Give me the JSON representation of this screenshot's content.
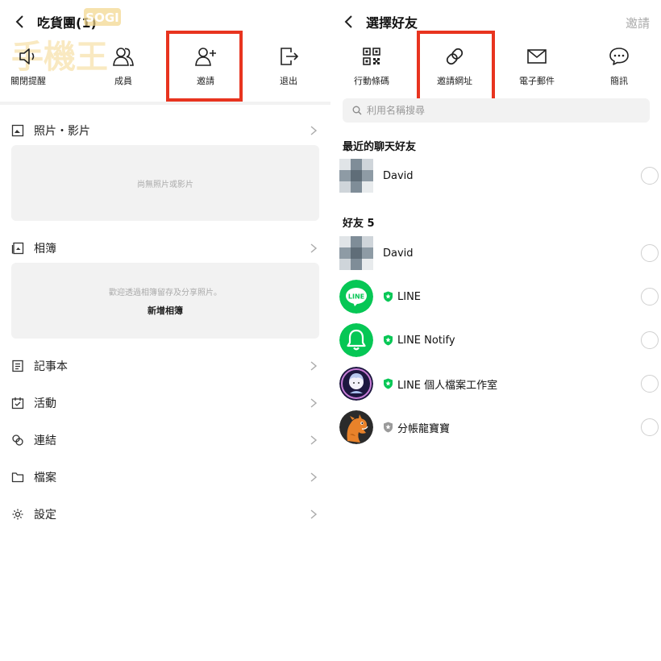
{
  "left": {
    "header": {
      "title": "吃貨團(1)"
    },
    "actions": [
      {
        "label": "關閉提醒",
        "icon": "speaker-icon"
      },
      {
        "label": "成員",
        "icon": "members-icon"
      },
      {
        "label": "邀請",
        "icon": "add-person-icon"
      },
      {
        "label": "退出",
        "icon": "exit-icon"
      }
    ],
    "sections": {
      "photos": {
        "label": "照片・影片",
        "empty_text": "尚無照片或影片"
      },
      "albums": {
        "label": "相簿",
        "empty_text": "歡迎透過相簿留存及分享照片。",
        "create_label": "新增相簿"
      },
      "notes": {
        "label": "記事本"
      },
      "events": {
        "label": "活動"
      },
      "links": {
        "label": "連結"
      },
      "files": {
        "label": "檔案"
      },
      "settings": {
        "label": "設定"
      }
    },
    "watermark": {
      "text": "SOGI"
    }
  },
  "right": {
    "header": {
      "title": "選擇好友",
      "action": "邀請"
    },
    "actions": [
      {
        "label": "行動條碼",
        "icon": "qr-code-icon"
      },
      {
        "label": "邀請網址",
        "icon": "link-icon"
      },
      {
        "label": "電子郵件",
        "icon": "mail-icon"
      },
      {
        "label": "簡訊",
        "icon": "chat-bubble-icon"
      }
    ],
    "search": {
      "placeholder": "利用名稱搜尋"
    },
    "recent": {
      "heading": "最近的聊天好友",
      "items": [
        {
          "name": "David"
        }
      ]
    },
    "friends": {
      "heading": "好友 5",
      "items": [
        {
          "name": "David",
          "official": false
        },
        {
          "name": "LINE",
          "official": true
        },
        {
          "name": "LINE Notify",
          "official": true
        },
        {
          "name": "LINE 個人檔案工作室",
          "official": true
        },
        {
          "name": "分帳龍寶寶",
          "official": true
        }
      ]
    },
    "line_logo_text": "LINE"
  },
  "colors": {
    "highlight": "#e8341f",
    "line_green": "#06c755",
    "official_badge": "#06c755",
    "gray_badge": "#9a9a9a"
  }
}
